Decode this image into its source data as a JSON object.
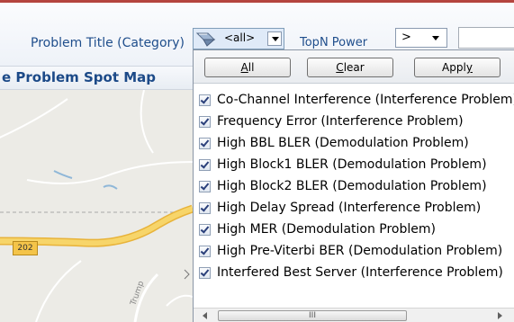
{
  "toolbar": {
    "problem_title_label": "Problem Title (Category)",
    "filter_value": "<all>",
    "topn_label": "TopN Power",
    "operator_value": ">",
    "topn_value": ""
  },
  "map": {
    "title": "e Problem Spot Map",
    "road_badge": "202",
    "road_text": "Trump"
  },
  "dropdown": {
    "buttons": {
      "all": {
        "mnemonic": "A",
        "rest": "ll"
      },
      "clear": {
        "mnemonic": "C",
        "rest": "lear"
      },
      "apply": {
        "before": "Appl",
        "mnemonic": "y"
      }
    },
    "items": [
      {
        "label": "Co-Channel Interference (Interference Problem)",
        "checked": true
      },
      {
        "label": "Frequency Error (Interference Problem)",
        "checked": true
      },
      {
        "label": "High BBL BLER (Demodulation Problem)",
        "checked": true
      },
      {
        "label": "High Block1 BLER (Demodulation Problem)",
        "checked": true
      },
      {
        "label": "High Block2 BLER (Demodulation Problem)",
        "checked": true
      },
      {
        "label": "High Delay Spread (Interference Problem)",
        "checked": true
      },
      {
        "label": "High MER (Demodulation Problem)",
        "checked": true
      },
      {
        "label": "High Pre-Viterbi BER (Demodulation Problem)",
        "checked": true
      },
      {
        "label": "Interfered Best Server (Interference Problem)",
        "checked": true
      }
    ],
    "scrollbar_grip": "III"
  },
  "icons": {
    "filter": "funnel-icon",
    "dropdown_arrow": "chevron-down-icon",
    "checkbox": "checkmark-icon"
  },
  "colors": {
    "label_blue": "#1f4e8c",
    "title_blue": "#1c4a88",
    "road_yellow": "#f4c449",
    "accent_line": "#b5453f"
  }
}
